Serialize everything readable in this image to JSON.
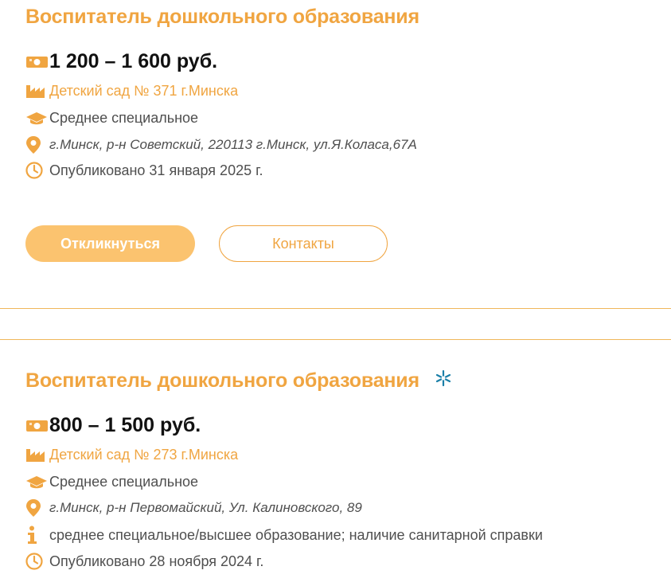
{
  "vacancies": [
    {
      "title": "Воспитатель дошкольного образования",
      "salary": "1 200 – 1 600 руб.",
      "company": "Детский сад № 371 г.Минска",
      "education": "Среднее специальное",
      "address": "г.Минск, р-н Советский, 220113 г.Минск, ул.Я.Коласа,67А",
      "published": "Опубликовано 31 января 2025 г.",
      "apply_label": "Откликнуться",
      "contacts_label": "Контакты"
    },
    {
      "title": "Воспитатель дошкольного образования",
      "salary": "800 – 1 500 руб.",
      "company": "Детский сад № 273 г.Минска",
      "education": "Среднее специальное",
      "address": "г.Минск, р-н Первомайский, Ул. Калиновского, 89",
      "requirements": "среднее специальное/высшее образование; наличие санитарной справки",
      "published": "Опубликовано 28 ноября 2024 г."
    }
  ],
  "colors": {
    "accent": "#f0a541",
    "button_fill": "#fbc36f",
    "badge": "#1a7fa8"
  },
  "icons": [
    "money-icon",
    "factory-icon",
    "graduation-cap-icon",
    "location-pin-icon",
    "info-icon",
    "clock-icon",
    "sparkle-icon"
  ]
}
